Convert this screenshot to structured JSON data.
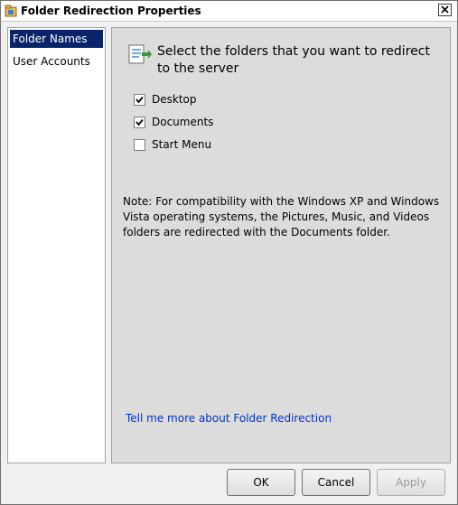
{
  "window": {
    "title": "Folder Redirection Properties"
  },
  "nav": {
    "items": [
      {
        "label": "Folder Names",
        "selected": true
      },
      {
        "label": "User Accounts",
        "selected": false
      }
    ]
  },
  "content": {
    "heading": "Select the folders that you want to redirect to the server",
    "folders": [
      {
        "label": "Desktop",
        "checked": true
      },
      {
        "label": "Documents",
        "checked": true
      },
      {
        "label": "Start Menu",
        "checked": false
      }
    ],
    "note": "Note: For compatibility with the Windows XP and Windows Vista operating systems, the Pictures, Music, and Videos folders are redirected with the Documents folder.",
    "link": "Tell me more about Folder Redirection"
  },
  "buttons": {
    "ok": "OK",
    "cancel": "Cancel",
    "apply": "Apply"
  },
  "colors": {
    "selection": "#0a246a",
    "link": "#0033cc",
    "panel": "#dcdcdc"
  }
}
